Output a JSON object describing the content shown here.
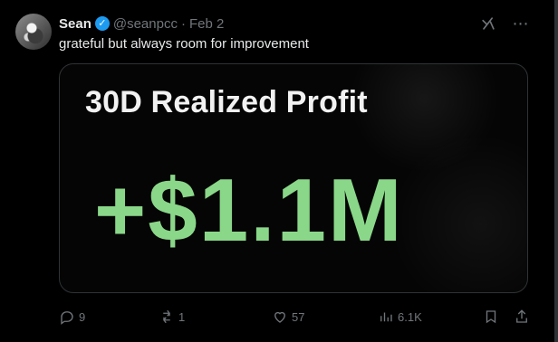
{
  "tweet": {
    "author_name": "Sean",
    "handle": "@seanpcc",
    "separator": "·",
    "date": "Feb 2",
    "text": "grateful but always room for improvement",
    "media": {
      "title": "30D Realized Profit",
      "value": "+$1.1M"
    },
    "actions": {
      "replies": "9",
      "reposts": "1",
      "likes": "57",
      "views": "6.1K"
    }
  },
  "colors": {
    "background": "#000000",
    "text": "#e7e9ea",
    "muted": "#71767b",
    "verified": "#1d9bf0",
    "profit_green": "#8ad789"
  },
  "icons": {
    "verified": "verified-badge-icon",
    "grok": "grok-icon",
    "more": "more-icon",
    "reply": "reply-icon",
    "repost": "repost-icon",
    "like": "like-icon",
    "views": "views-icon",
    "bookmark": "bookmark-icon",
    "share": "share-icon"
  }
}
